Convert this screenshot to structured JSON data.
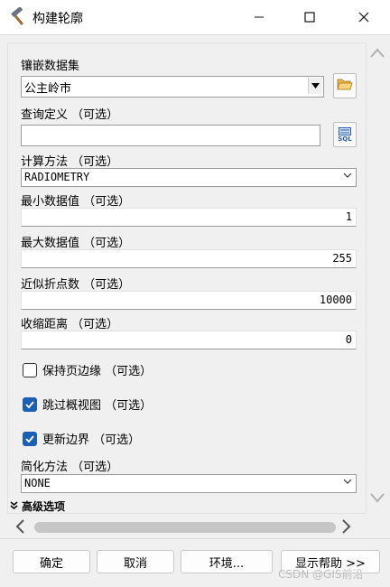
{
  "window": {
    "title": "构建轮廓",
    "minimize_glyph": "—",
    "maximize_glyph": "☐",
    "close_glyph": "✕",
    "icon": "hammer-icon"
  },
  "fields": {
    "mosaic_label": "镶嵌数据集",
    "mosaic_value": "公主岭市",
    "query_label": "查询定义 （可选）",
    "query_value": "",
    "sql_button": "SQL",
    "method_label": "计算方法 （可选）",
    "method_value": "RADIOMETRY",
    "min_label": "最小数据值 （可选）",
    "min_value": "1",
    "max_label": "最大数据值 （可选）",
    "max_value": "255",
    "vertices_label": "近似折点数 （可选）",
    "vertices_value": "10000",
    "shrink_label": "收缩距离 （可选）",
    "shrink_value": "0",
    "maintain_edges_label": "保持页边缘 （可选）",
    "maintain_edges_checked": false,
    "skip_overviews_label": "跳过概视图 （可选）",
    "skip_overviews_checked": true,
    "update_boundary_label": "更新边界 （可选）",
    "update_boundary_checked": true,
    "simplify_label": "简化方法 （可选）",
    "simplify_value": "NONE",
    "advanced_label": "高级选项"
  },
  "buttons": {
    "ok": "确定",
    "cancel": "取消",
    "env": "环境...",
    "help": "显示帮助 >>"
  },
  "watermark": "CSDN @GIS前沿",
  "colors": {
    "checkbox_accent": "#1a5fb4",
    "panel_bg": "#f0f0f0"
  }
}
